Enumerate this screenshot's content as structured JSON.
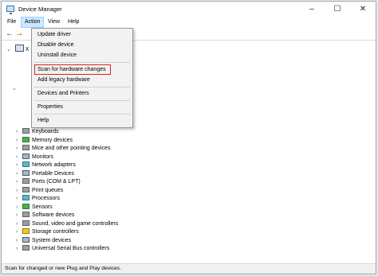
{
  "window": {
    "title": "Device Manager"
  },
  "menubar": {
    "file": "File",
    "action": "Action",
    "view": "View",
    "help": "Help"
  },
  "action_menu": {
    "items": [
      "Update driver",
      "Disable device",
      "Uninstall device",
      "Scan for hardware changes",
      "Add legacy hardware",
      "Devices and Printers",
      "Properties",
      "Help"
    ],
    "highlighted": "Scan for hardware changes",
    "highlight_color": "#e02020"
  },
  "tree": {
    "root": "X",
    "nodes": [
      "Keyboards",
      "Memory devices",
      "Mice and other pointing devices",
      "Monitors",
      "Network adapters",
      "Portable Devices",
      "Ports (COM & LPT)",
      "Print queues",
      "Processors",
      "Sensors",
      "Software devices",
      "Sound, video and game controllers",
      "Storage controllers",
      "System devices",
      "Universal Serial Bus controllers"
    ]
  },
  "statusbar": {
    "text": "Scan for changed or new Plug and Play devices."
  }
}
